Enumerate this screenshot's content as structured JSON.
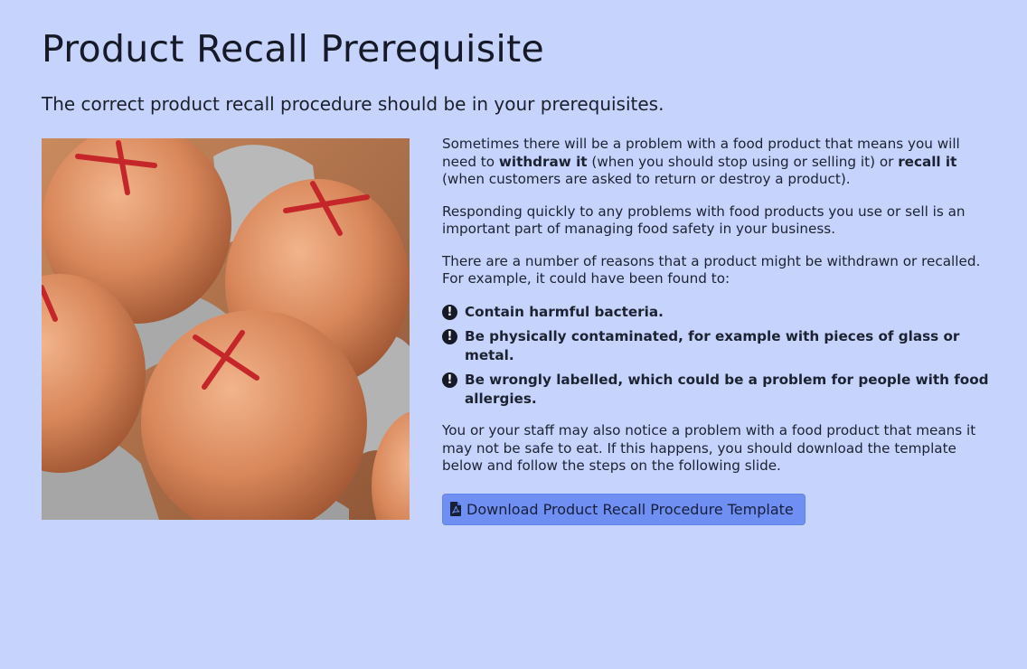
{
  "page": {
    "title": "Product Recall Prerequisite",
    "subtitle": "The correct product recall procedure should be in your prerequisites."
  },
  "image": {
    "icon": "eggs-with-red-crosses-photo"
  },
  "content": {
    "p1_before": "Sometimes there will be a problem with a food product that means you will need to ",
    "p1_bold1": "withdraw it",
    "p1_middle": " (when you should stop using or selling it) or ",
    "p1_bold2": "recall it",
    "p1_after": " (when customers are asked to return or destroy a product).",
    "p2": "Responding quickly to any problems with food products you use or sell is an important part of managing food safety in your business.",
    "p3": "There are a number of reasons that a product might be withdrawn or recalled. For example, it could have been found to:",
    "reasons": [
      "Contain harmful bacteria.",
      "Be physically contaminated, for example with pieces of glass or metal.",
      "Be wrongly labelled, which could be a problem for people with food allergies."
    ],
    "p4": "You or your staff may also notice a problem with a food product that means it may not be safe to eat. If this happens, you should download the template below and follow the steps on the following slide."
  },
  "download_button": {
    "label": "Download Product Recall Procedure Template",
    "icon": "file-pdf-icon"
  },
  "colors": {
    "background": "#c5d3fd",
    "button": "#6f8ff3"
  }
}
